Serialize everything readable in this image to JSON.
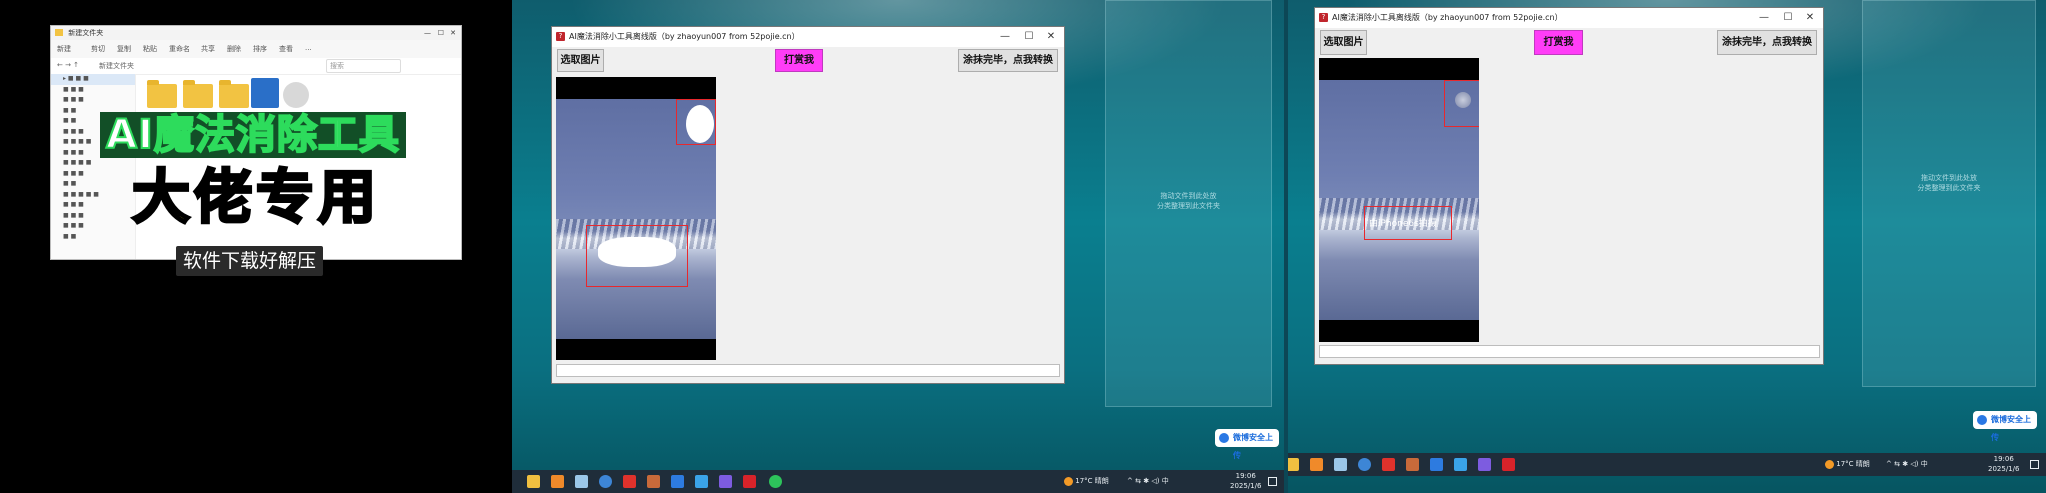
{
  "panel1": {
    "explorer": {
      "title": "新建文件夹",
      "toolbar": [
        "新建",
        "剪切",
        "复制",
        "粘贴",
        "重命名",
        "共享",
        "删除",
        "排序",
        "查看",
        "..."
      ],
      "address": "新建文件夹",
      "search_placeholder": "搜索"
    },
    "overlay": {
      "title": "AI魔法消除工具",
      "headline": "大佬专用",
      "subtitle": "软件下载好解压"
    }
  },
  "app": {
    "title": "AI魔法消除小工具离线版（by zhaoyun007 from 52pojie.cn）",
    "buttons": {
      "select_image": "选取图片",
      "donate": "打赏我",
      "convert": "涂抹完毕，点我转换"
    }
  },
  "panel3": {
    "watermark_text": "由iPhone6s拍摄"
  },
  "desktop": {
    "ghost_text": "拖动文件到此处放\n分类整理到此文件夹",
    "upload_label": "微博安全上传"
  },
  "taskbar": {
    "weather": "17°C 晴朗",
    "time": "19:06",
    "date": "2025/1/6",
    "ime": "中"
  },
  "colors": {
    "donate_button": "#ff3df7",
    "mark_box": "#e8282d",
    "accent_green": "#2ddc5c",
    "headline_yellow": "#f5e21b"
  }
}
